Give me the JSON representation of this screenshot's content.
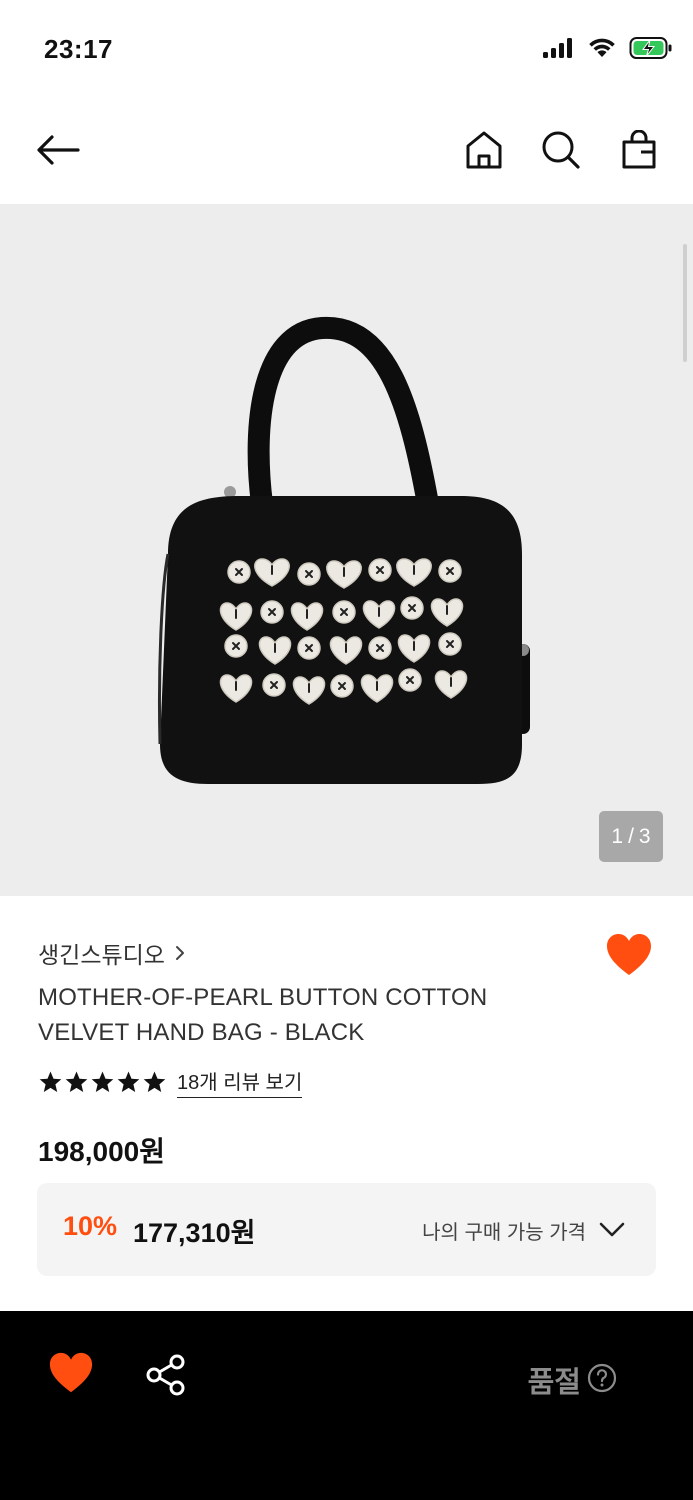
{
  "status_bar": {
    "time": "23:17"
  },
  "header": {
    "back_icon": "arrow-left-icon",
    "home_icon": "home-icon",
    "search_icon": "search-icon",
    "cart_icon": "shopping-bag-icon"
  },
  "gallery": {
    "counter_current": "1",
    "counter_separator": "/",
    "counter_total": "3"
  },
  "product": {
    "brand": "생긴스튜디오",
    "brand_chevron": "›",
    "title_line1": "MOTHER-OF-PEARL BUTTON COTTON",
    "title_line2": "VELVET HAND BAG - BLACK",
    "rating_stars": 5,
    "review_link": "18개 리뷰 보기",
    "price": "198,000원",
    "discount_percent": "10%",
    "discount_price": "177,310원",
    "discount_label": "나의 구매 가능 가격"
  },
  "bottom_bar": {
    "status": "품절"
  },
  "colors": {
    "accent": "#ff4e10",
    "gallery_bg": "#ededed",
    "bottom_bg": "#000000"
  }
}
